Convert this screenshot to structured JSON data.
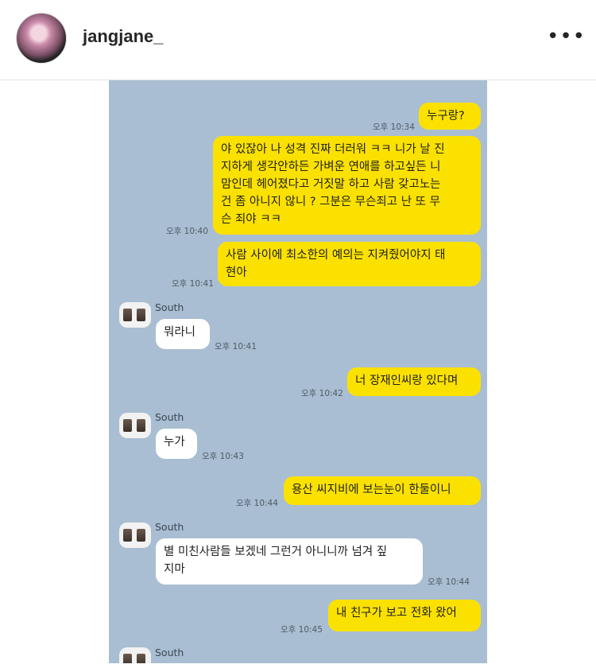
{
  "header": {
    "username": "jangjane_",
    "more_icon": "more-horizontal-icon"
  },
  "messages": [
    {
      "side": "me",
      "text": "누구랑?",
      "time": "오후 10:34"
    },
    {
      "side": "me",
      "text": "야 있잖아 나 성격 진짜 더러워 ㅋㅋ 니가 날 진\n지하게 생각안하든 가벼운 연애를 하고싶든 니\n맘인데  헤어졌다고 거짓말 하고 사람 갖고노는\n건 좀 아니지 않니 ? 그분은 무슨죄고 난 또 무\n슨 죄야 ㅋㅋ",
      "time": "오후 10:40"
    },
    {
      "side": "me",
      "text": "사람 사이에 최소한의 예의는 지켜줬어야지 태\n현아",
      "time": "오후 10:41"
    },
    {
      "side": "them",
      "name": "South",
      "text": "뭐라니",
      "time": "오후 10:41"
    },
    {
      "side": "me",
      "text": "너 장재인씨랑 있다며",
      "time": "오후 10:42"
    },
    {
      "side": "them",
      "name": "South",
      "text": "누가",
      "time": "오후 10:43"
    },
    {
      "side": "me",
      "text": "용산 씨지비에 보는눈이 한둘이니",
      "time": "오후 10:44"
    },
    {
      "side": "them",
      "name": "South",
      "text": "별 미친사람들 보겠네 그런거 아니니까 넘겨 짚\n지마",
      "time": "오후 10:44"
    },
    {
      "side": "me",
      "text": "내 친구가 보고 전화 왔어",
      "time": "오후 10:45"
    },
    {
      "side": "them",
      "name": "South",
      "text": "",
      "time": ""
    }
  ]
}
